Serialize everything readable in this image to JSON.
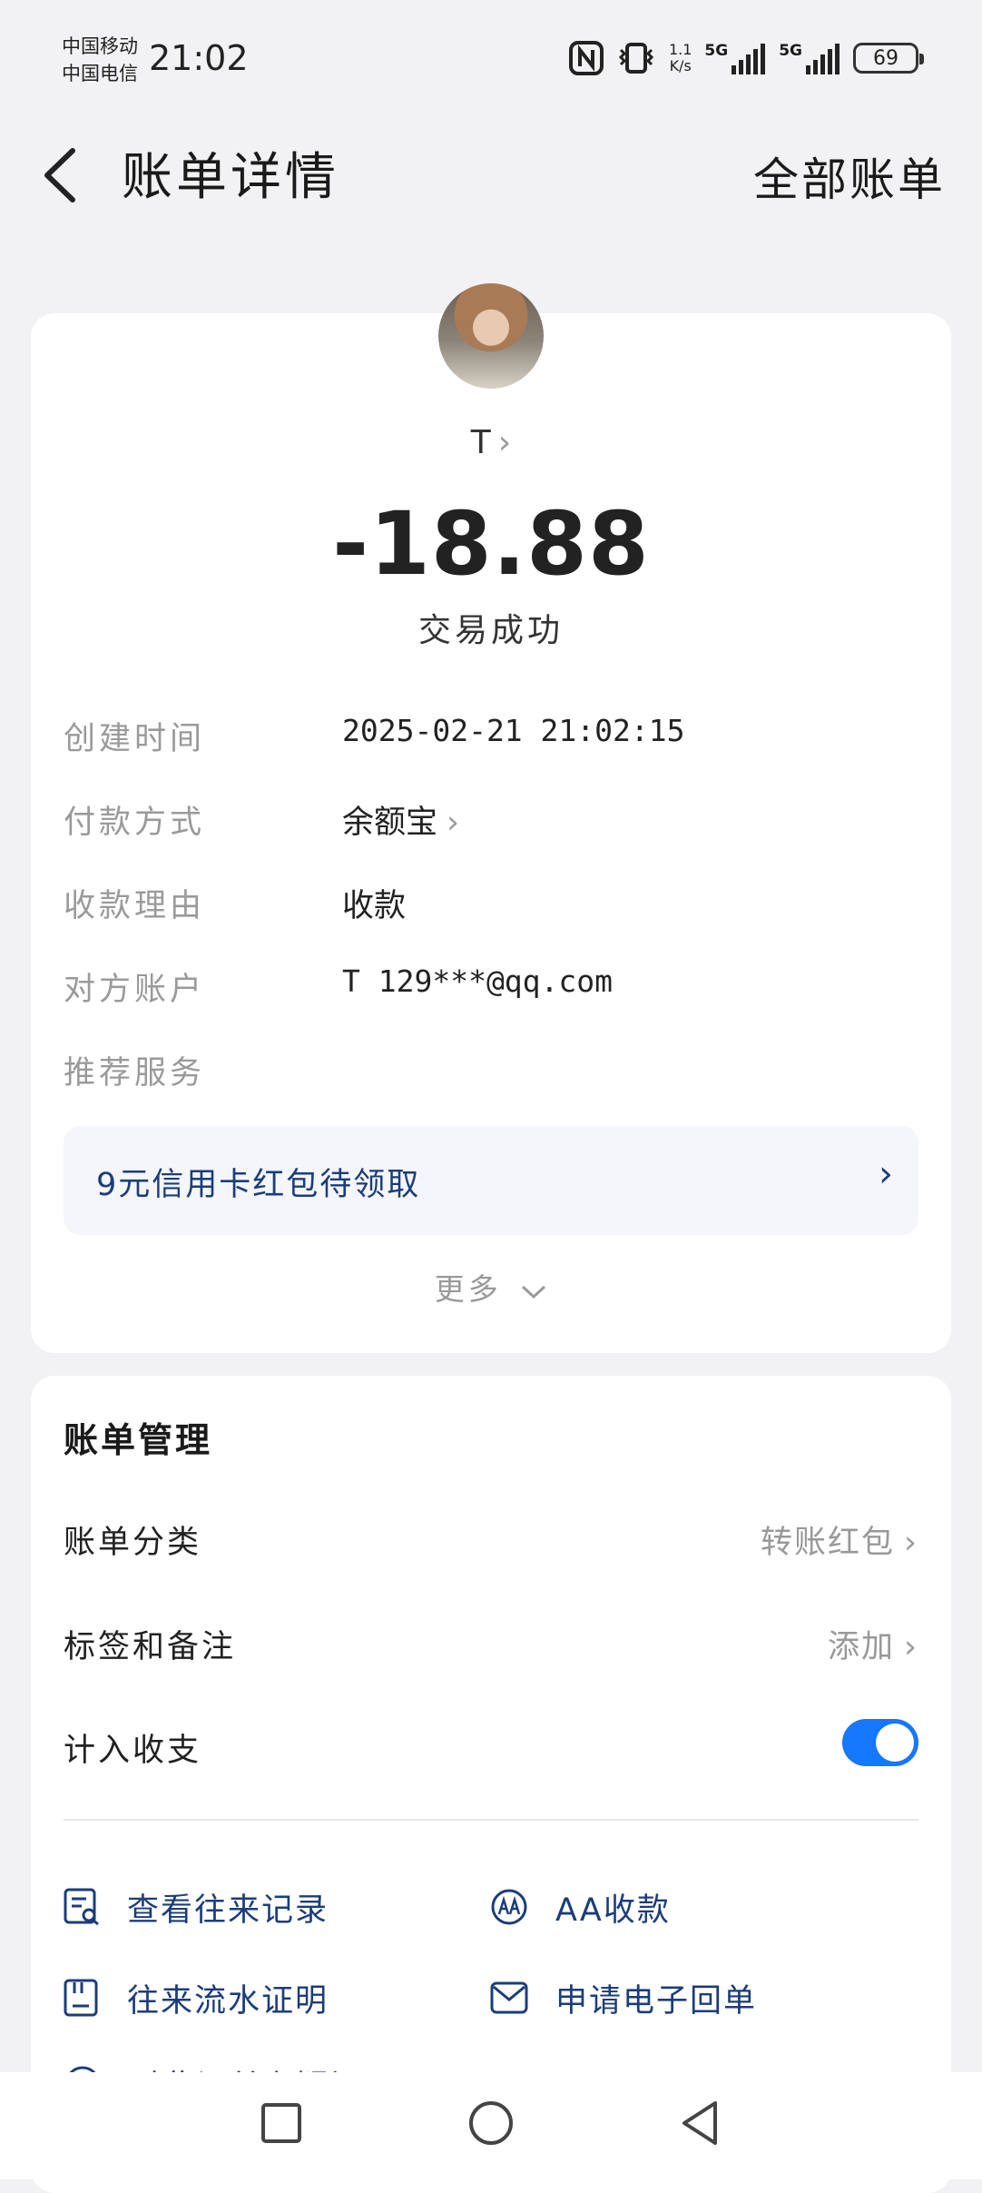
{
  "status_bar": {
    "carrier_1": "中国移动",
    "carrier_2": "中国电信",
    "time": "21:02",
    "speed_top": "1.1",
    "speed_bottom": "K/s",
    "net_1": "5G",
    "net_2": "5G",
    "battery": "69"
  },
  "header": {
    "title": "账单详情",
    "right_link": "全部账单"
  },
  "transaction": {
    "payee": "T",
    "amount": "-18.88",
    "status": "交易成功",
    "details": [
      {
        "label": "创建时间",
        "value": "2025-02-21 21:02:15"
      },
      {
        "label": "付款方式",
        "value": "余额宝"
      },
      {
        "label": "收款理由",
        "value": "收款"
      },
      {
        "label": "对方账户",
        "value": "T 129***@qq.com"
      },
      {
        "label": "推荐服务",
        "value": ""
      }
    ],
    "promo": "9元信用卡红包待领取",
    "more": "更多"
  },
  "management": {
    "title": "账单管理",
    "category_label": "账单分类",
    "category_value": "转账红包",
    "tags_label": "标签和备注",
    "tags_value": "添加",
    "include_label": "计入收支",
    "include_enabled": true,
    "actions": [
      {
        "label": "查看往来记录",
        "icon": "record-search-icon"
      },
      {
        "label": "AA收款",
        "icon": "aa-icon"
      },
      {
        "label": "往来流水证明",
        "icon": "statement-icon"
      },
      {
        "label": "申请电子回单",
        "icon": "envelope-icon"
      },
      {
        "label": "对此订单有疑问",
        "icon": "question-icon"
      }
    ]
  },
  "colors": {
    "accent": "#1677ff",
    "link": "#1c3d7a",
    "page_bg": "#f2f2f4"
  }
}
